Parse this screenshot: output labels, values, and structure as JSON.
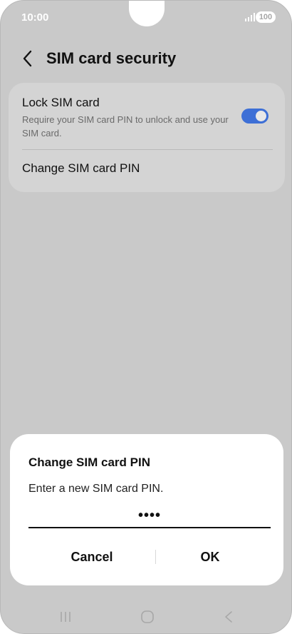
{
  "status_bar": {
    "time": "10:00",
    "battery": "100",
    "signal_icon": "signal-icon"
  },
  "header": {
    "title": "SIM card security",
    "back_icon": "chevron-left-icon"
  },
  "settings": {
    "lock_sim": {
      "title": "Lock SIM card",
      "description": "Require your SIM card PIN to unlock and use your SIM card.",
      "enabled": true
    },
    "change_pin": {
      "label": "Change SIM card PIN"
    }
  },
  "dialog": {
    "title": "Change SIM card PIN",
    "message": "Enter a new SIM card PIN.",
    "pin_value": "••••",
    "cancel_label": "Cancel",
    "ok_label": "OK"
  },
  "nav": {
    "recents_icon": "recents-icon",
    "home_icon": "home-icon",
    "back_icon": "back-icon"
  },
  "colors": {
    "toggle_on": "#3d6fd6",
    "scrim": "#c9c9c9",
    "card": "#d4d4d4"
  }
}
